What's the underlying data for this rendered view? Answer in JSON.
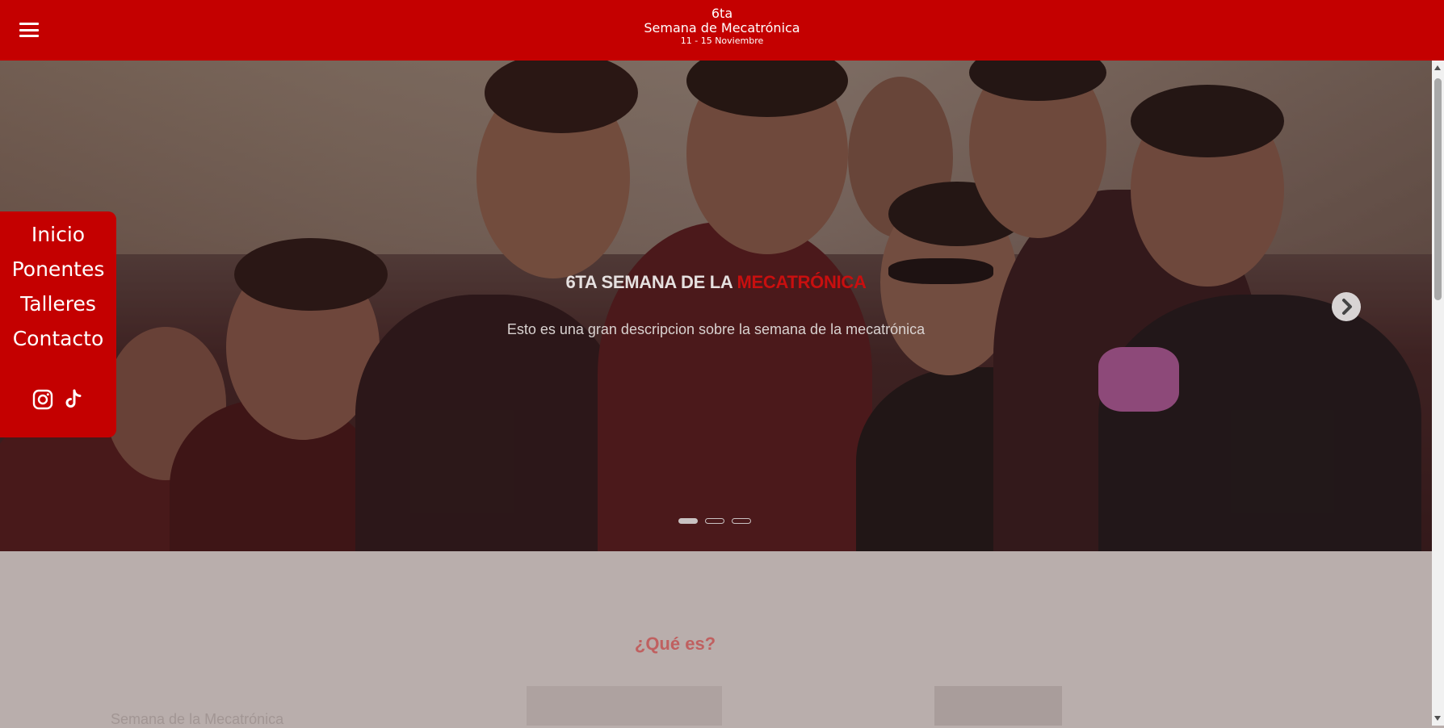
{
  "header": {
    "menu_icon": "hamburger-menu-icon",
    "title_line1": "6ta",
    "title_line2": "Semana de Mecatrónica",
    "dates": "11 - 15 Noviembre",
    "bg_color": "#c40000"
  },
  "sidemenu": {
    "items": [
      {
        "label": "Inicio"
      },
      {
        "label": "Ponentes"
      },
      {
        "label": "Talleres"
      },
      {
        "label": "Contacto"
      }
    ],
    "social": [
      "instagram-icon",
      "tiktok-icon"
    ]
  },
  "carousel": {
    "title_prefix": "6TA SEMANA DE LA",
    "title_accent": "MECATRÓNICA",
    "description": "Esto es una gran descripcion sobre la semana de la mecatrónica",
    "slides": 3,
    "active_slide": 1,
    "next_icon": "chevron-right-icon"
  },
  "content": {
    "section_title": "¿Qué es?",
    "subtitle": "Semana de la Mecatrónica"
  }
}
